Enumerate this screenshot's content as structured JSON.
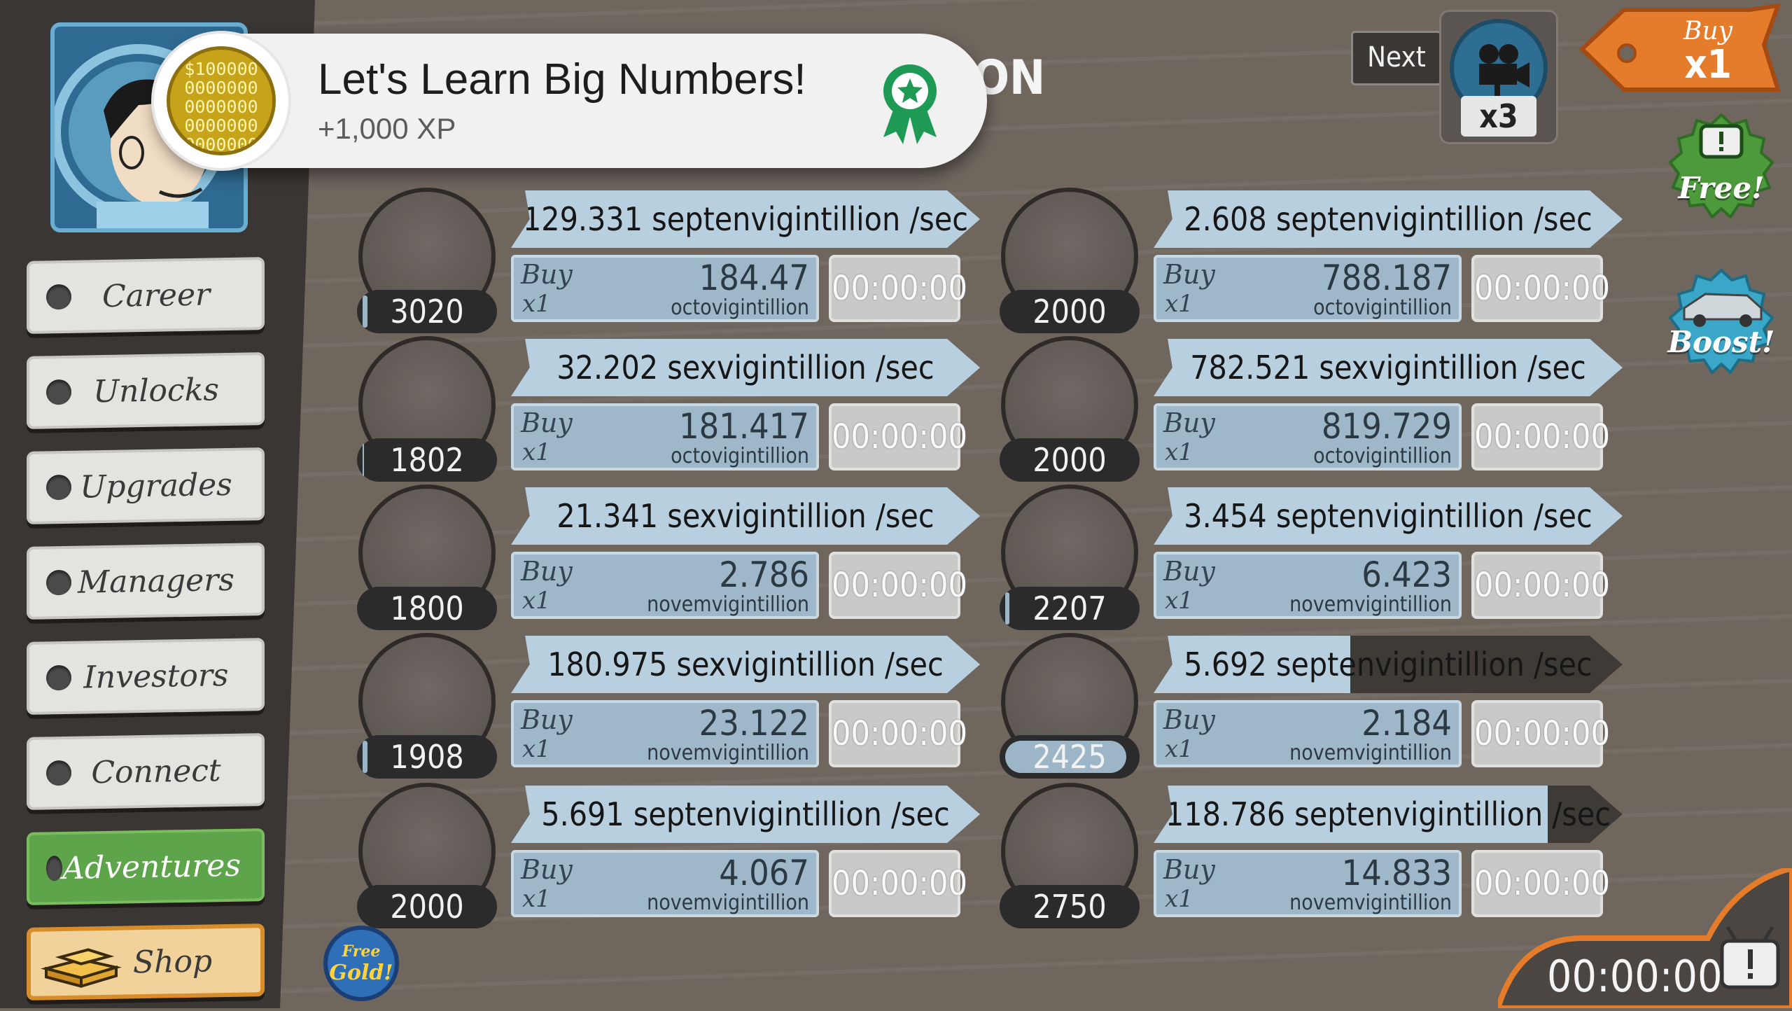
{
  "notification": {
    "title": "Let's Learn Big Numbers!",
    "subtitle": "+1,000 XP",
    "coin_text": [
      "$100000",
      "0000000",
      "0000000",
      "0000000",
      "0000000"
    ]
  },
  "header": {
    "partial_title": "ON"
  },
  "sidebar": {
    "items": [
      {
        "label": "Career"
      },
      {
        "label": "Unlocks"
      },
      {
        "label": "Upgrades"
      },
      {
        "label": "Managers"
      },
      {
        "label": "Investors"
      },
      {
        "label": "Connect"
      },
      {
        "label": "Adventures"
      },
      {
        "label": "Shop"
      }
    ]
  },
  "top_right": {
    "next_label": "Next",
    "multiplier_label": "x3",
    "buy_label": "Buy",
    "buy_mult": "x1",
    "free_label": "Free!",
    "boost_label": "Boost!"
  },
  "free_gold": {
    "line1": "Free",
    "line2": "Gold!"
  },
  "bottom_timer": {
    "time": "00:00:00"
  },
  "businesses": [
    {
      "icon": "lemon-icon",
      "count": "3020",
      "rate": "129.331 septenvigintillion /sec",
      "buy": "Buy",
      "mult": "x1",
      "price": "184.47",
      "unit": "octovigintillion",
      "timer": "00:00:00",
      "progress": 0.0,
      "count_progress": 0.04
    },
    {
      "icon": "shrimp-icon",
      "count": "2000",
      "rate": "2.608 septenvigintillion /sec",
      "buy": "Buy",
      "mult": "x1",
      "price": "788.187",
      "unit": "octovigintillion",
      "timer": "00:00:00",
      "progress": 0.0,
      "count_progress": 0.0
    },
    {
      "icon": "newspaper-icon",
      "count": "1802",
      "rate": "32.202 sexvigintillion /sec",
      "buy": "Buy",
      "mult": "x1",
      "price": "181.417",
      "unit": "octovigintillion",
      "timer": "00:00:00",
      "progress": 0.0,
      "count_progress": 0.01
    },
    {
      "icon": "hockey-stick-icon",
      "count": "2000",
      "rate": "782.521 sexvigintillion /sec",
      "buy": "Buy",
      "mult": "x1",
      "price": "819.729",
      "unit": "octovigintillion",
      "timer": "00:00:00",
      "progress": 0.0,
      "count_progress": 0.0
    },
    {
      "icon": "car-wash-icon",
      "count": "1800",
      "rate": "21.341 sexvigintillion /sec",
      "buy": "Buy",
      "mult": "x1",
      "price": "2.786",
      "unit": "novemvigintillion",
      "timer": "00:00:00",
      "progress": 0.0,
      "count_progress": 0.0
    },
    {
      "icon": "movie-camera-icon",
      "count": "2207",
      "rate": "3.454 septenvigintillion /sec",
      "buy": "Buy",
      "mult": "x1",
      "price": "6.423",
      "unit": "novemvigintillion",
      "timer": "00:00:00",
      "progress": 0.0,
      "count_progress": 0.03
    },
    {
      "icon": "pizza-icon",
      "count": "1908",
      "rate": "180.975 sexvigintillion /sec",
      "buy": "Buy",
      "mult": "x1",
      "price": "23.122",
      "unit": "novemvigintillion",
      "timer": "00:00:00",
      "progress": 0.0,
      "count_progress": 0.04
    },
    {
      "icon": "bank-icon",
      "count": "2425",
      "rate": "5.692 septenvigintillion /sec",
      "buy": "Buy",
      "mult": "x1",
      "price": "2.184",
      "unit": "novemvigintillion",
      "timer": "00:00:00",
      "progress": 0.42,
      "count_progress": 0.94
    },
    {
      "icon": "donut-icon",
      "count": "2000",
      "rate": "5.691 septenvigintillion /sec",
      "buy": "Buy",
      "mult": "x1",
      "price": "4.067",
      "unit": "novemvigintillion",
      "timer": "00:00:00",
      "progress": 0.0,
      "count_progress": 0.0
    },
    {
      "icon": "oil-rig-icon",
      "count": "2750",
      "rate": "118.786 septenvigintillion /sec",
      "buy": "Buy",
      "mult": "x1",
      "price": "14.833",
      "unit": "novemvigintillion",
      "timer": "00:00:00",
      "progress": 0.84,
      "count_progress": 0.0
    }
  ]
}
